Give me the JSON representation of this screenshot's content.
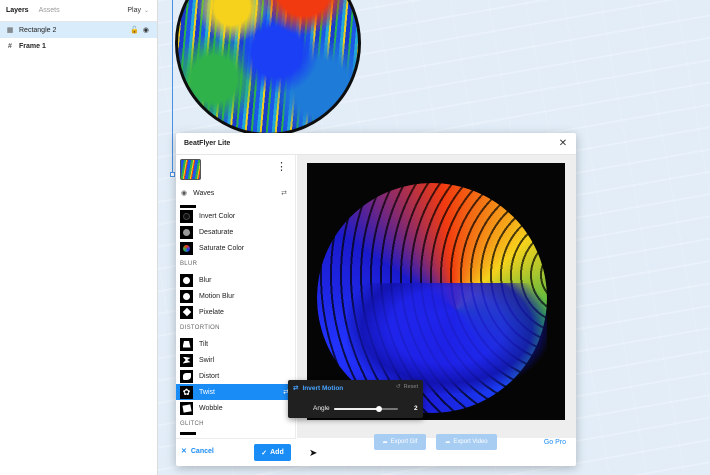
{
  "layers_panel": {
    "tabs": [
      {
        "label": "Layers"
      },
      {
        "label": "Assets"
      }
    ],
    "play_label": "Play",
    "layers": [
      {
        "name": "Rectangle 2"
      },
      {
        "name": "Frame 1"
      }
    ]
  },
  "plugin": {
    "title": "BeatFlyer Lite",
    "active_effect": "Waves",
    "groups": [
      {
        "items": [
          "Invert Color",
          "Desaturate",
          "Saturate Color"
        ]
      },
      {
        "header": "BLUR",
        "items": [
          "Blur",
          "Motion Blur",
          "Pixelate"
        ]
      },
      {
        "header": "DISTORTION",
        "items": [
          "Tilt",
          "Swirl",
          "Distort",
          "Twist",
          "Wobble"
        ]
      },
      {
        "header": "GLITCH"
      }
    ],
    "selected_item": "Twist",
    "cancel_label": "Cancel",
    "add_label": "Add",
    "export_gif_label": "Export Gif",
    "export_video_label": "Export Video",
    "go_pro_label": "Go Pro"
  },
  "popover": {
    "invert_motion_label": "Invert Motion",
    "reset_label": "Reset",
    "angle_label": "Angle",
    "angle_value": "2",
    "angle_fraction": 0.7
  },
  "colors": {
    "accent": "#1a8cf5",
    "selected_row": "#d9ecfb",
    "popover_bg": "#202020"
  }
}
